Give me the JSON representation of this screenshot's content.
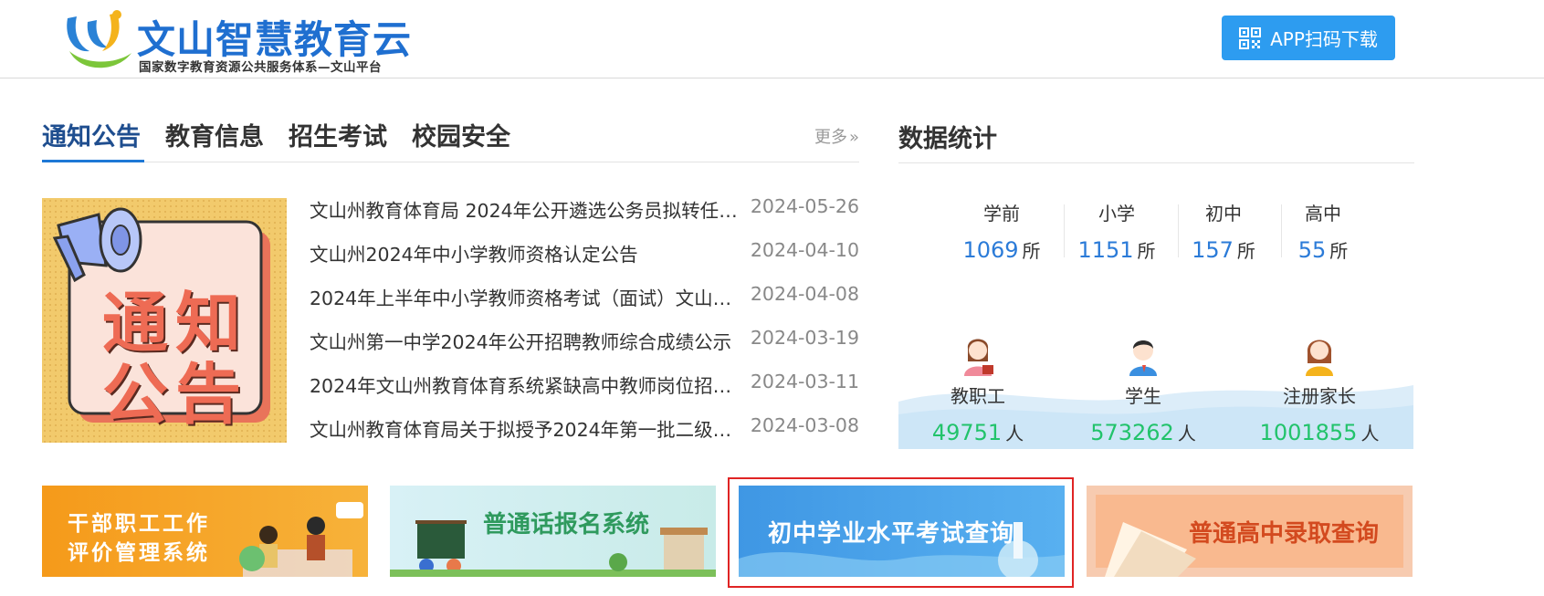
{
  "header": {
    "logo_title": "文山智慧教育云",
    "logo_subtitle": "国家数字教育资源公共服务体系—文山平台",
    "app_download_label": "APP扫码下载"
  },
  "tabs": {
    "items": [
      "通知公告",
      "教育信息",
      "招生考试",
      "校园安全"
    ],
    "more_label": "更多"
  },
  "notice_image": {
    "text_line1": "通知",
    "text_line2": "公告"
  },
  "news": [
    {
      "title": "文山州教育体育局 2024年公开遴选公务员拟转任人...",
      "date": "2024-05-26"
    },
    {
      "title": "文山州2024年中小学教师资格认定公告",
      "date": "2024-04-10"
    },
    {
      "title": "2024年上半年中小学教师资格考试（面试）文山考...",
      "date": "2024-04-08"
    },
    {
      "title": "文山州第一中学2024年公开招聘教师综合成绩公示",
      "date": "2024-03-19"
    },
    {
      "title": "2024年文山州教育体育系统紧缺高中教师岗位招聘...",
      "date": "2024-03-11"
    },
    {
      "title": "文山州教育体育局关于拟授予2024年第一批二级运...",
      "date": "2024-03-08"
    }
  ],
  "stats": {
    "title": "数据统计",
    "schools": [
      {
        "label": "学前",
        "value": "1069",
        "unit": "所"
      },
      {
        "label": "小学",
        "value": "1151",
        "unit": "所"
      },
      {
        "label": "初中",
        "value": "157",
        "unit": "所"
      },
      {
        "label": "高中",
        "value": "55",
        "unit": "所"
      }
    ],
    "people": [
      {
        "label": "教职工",
        "value": "49751",
        "unit": "人"
      },
      {
        "label": "学生",
        "value": "573262",
        "unit": "人"
      },
      {
        "label": "注册家长",
        "value": "1001855",
        "unit": "人"
      }
    ]
  },
  "banners": [
    {
      "line1": "干部职工工作",
      "line2": "评价管理系统"
    },
    {
      "line1": "普通话报名系统",
      "line2": ""
    },
    {
      "line1": "初中学业水平考试查询",
      "line2": ""
    },
    {
      "line1": "普通高中录取查询",
      "line2": ""
    }
  ],
  "colors": {
    "brand_blue": "#1f6fd0",
    "app_button": "#2d9cf0",
    "school_value": "#2b7bd8",
    "people_value": "#22c36b",
    "highlight_border": "#e02424"
  }
}
